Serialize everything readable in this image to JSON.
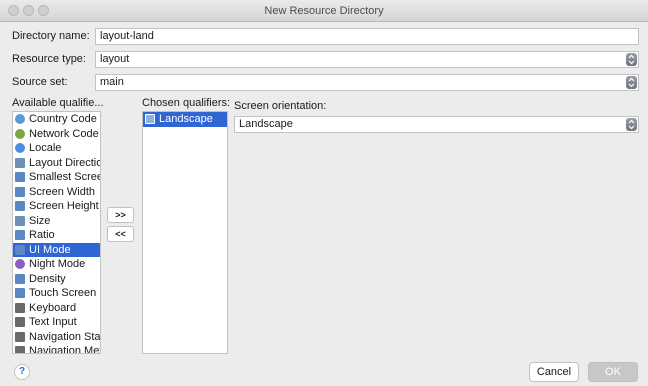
{
  "window": {
    "title": "New Resource Directory"
  },
  "form": {
    "directory_name_label": "Directory name:",
    "directory_name_value": "layout-land",
    "resource_type_label": "Resource type:",
    "resource_type_value": "layout",
    "source_set_label": "Source set:",
    "source_set_value": "main"
  },
  "available": {
    "label": "Available qualifie...",
    "items": [
      {
        "label": "Country Code",
        "icon": "globe-icon"
      },
      {
        "label": "Network Code",
        "icon": "network-icon"
      },
      {
        "label": "Locale",
        "icon": "locale-icon"
      },
      {
        "label": "Layout Directio",
        "icon": "layout-direction-icon"
      },
      {
        "label": "Smallest Screen",
        "icon": "smallest-screen-icon"
      },
      {
        "label": "Screen Width",
        "icon": "screen-width-icon"
      },
      {
        "label": "Screen Height",
        "icon": "screen-height-icon"
      },
      {
        "label": "Size",
        "icon": "size-icon"
      },
      {
        "label": "Ratio",
        "icon": "ratio-icon"
      },
      {
        "label": "UI Mode",
        "icon": "ui-mode-icon",
        "selected": true
      },
      {
        "label": "Night Mode",
        "icon": "night-mode-icon"
      },
      {
        "label": "Density",
        "icon": "density-icon"
      },
      {
        "label": "Touch Screen",
        "icon": "touch-screen-icon"
      },
      {
        "label": "Keyboard",
        "icon": "keyboard-icon"
      },
      {
        "label": "Text Input",
        "icon": "text-input-icon"
      },
      {
        "label": "Navigation State",
        "icon": "navigation-state-icon"
      },
      {
        "label": "Navigation Meth",
        "icon": "navigation-method-icon"
      }
    ]
  },
  "buttons": {
    "add": ">>",
    "remove": "<<",
    "cancel": "Cancel",
    "ok": "OK",
    "help": "?"
  },
  "chosen": {
    "label": "Chosen qualifiers:",
    "items": [
      {
        "label": "Landscape",
        "icon": "orientation-icon",
        "selected": true
      }
    ]
  },
  "orientation": {
    "label": "Screen orientation:",
    "value": "Landscape"
  },
  "colors": {
    "selection": "#2f66d4",
    "ok_button": "#c7c7c7"
  }
}
